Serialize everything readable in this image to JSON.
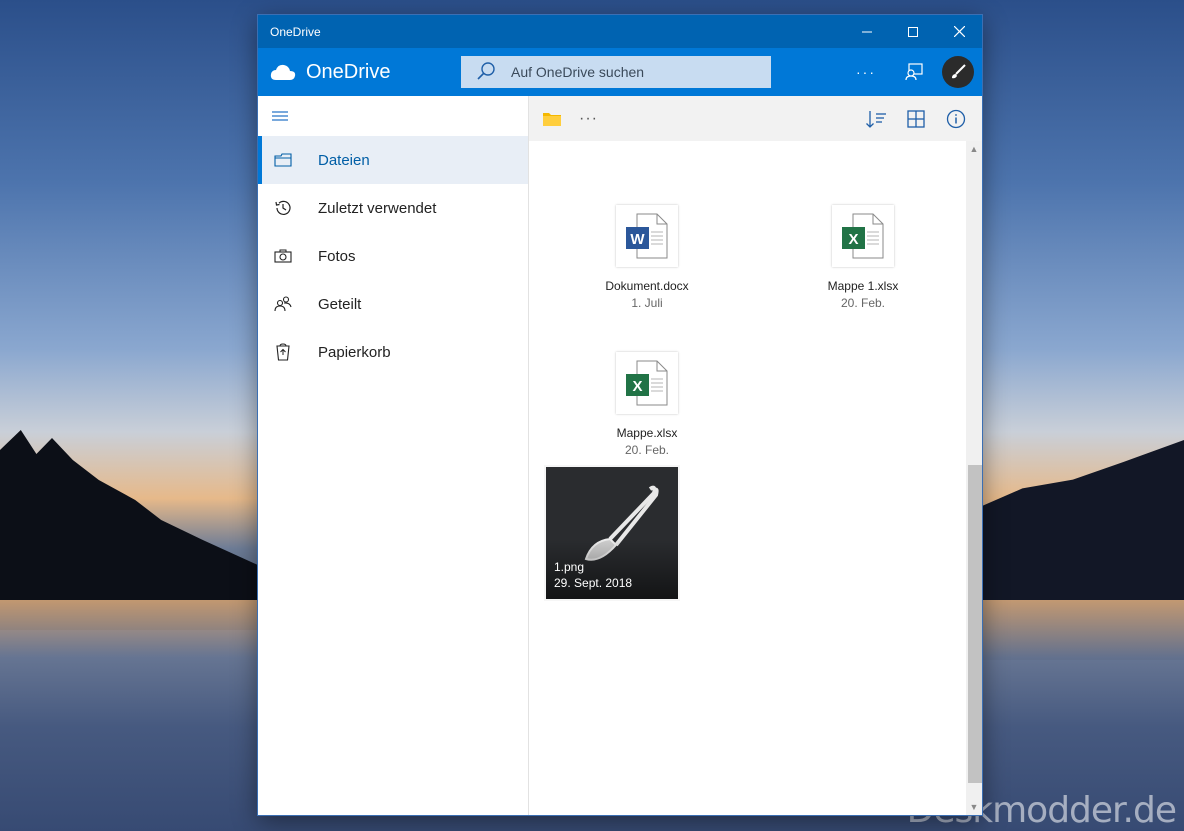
{
  "window": {
    "title": "OneDrive"
  },
  "app": {
    "name": "OneDrive"
  },
  "search": {
    "placeholder": "Auf OneDrive suchen"
  },
  "sidebar": {
    "items": [
      {
        "label": "Dateien",
        "icon": "folder-tab-icon",
        "active": true
      },
      {
        "label": "Zuletzt verwendet",
        "icon": "history-icon",
        "active": false
      },
      {
        "label": "Fotos",
        "icon": "camera-icon",
        "active": false
      },
      {
        "label": "Geteilt",
        "icon": "people-icon",
        "active": false
      },
      {
        "label": "Papierkorb",
        "icon": "recycle-bin-icon",
        "active": false
      }
    ]
  },
  "files": [
    {
      "name": "Dokument.docx",
      "date": "1. Juli",
      "type": "word",
      "badge": "W",
      "color": "#2b579a"
    },
    {
      "name": "Mappe 1.xlsx",
      "date": "20. Feb.",
      "type": "excel",
      "badge": "X",
      "color": "#217346"
    },
    {
      "name": "Mappe.xlsx",
      "date": "20. Feb.",
      "type": "excel",
      "badge": "X",
      "color": "#217346"
    },
    {
      "name": "1.png",
      "date": "29. Sept. 2018",
      "type": "image"
    }
  ],
  "watermark": "Deskmodder.de",
  "colors": {
    "titlebar": "#0063b1",
    "appbar": "#0078d7",
    "accent": "#0078d7"
  }
}
